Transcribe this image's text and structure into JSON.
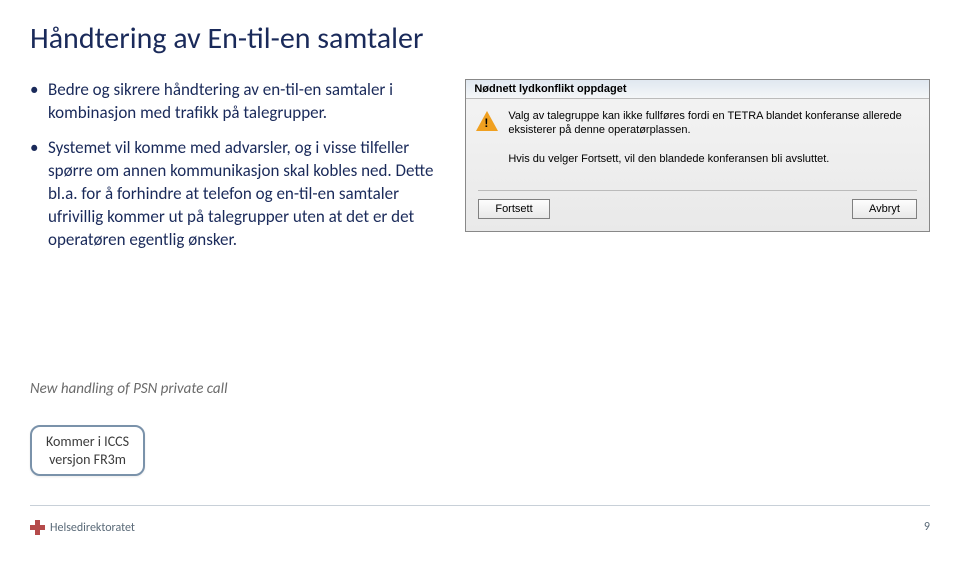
{
  "title": "Håndtering av En-til-en samtaler",
  "bullets": [
    "Bedre og sikrere håndtering av en-til-en samtaler i kombinasjon med trafikk på talegrupper.",
    "Systemet vil komme med advarsler, og i visse tilfeller spørre om annen kommunikasjon skal kobles ned. Dette bl.a. for å forhindre at telefon og en-til-en samtaler ufrivillig kommer ut på talegrupper uten at det er det operatøren egentlig ønsker."
  ],
  "dialog": {
    "title": "Nødnett lydkonflikt oppdaget",
    "line1": "Valg av talegruppe kan ikke fullføres fordi en TETRA blandet konferanse allerede eksisterer på denne operatørplassen.",
    "line2": "Hvis du velger Fortsett, vil den blandede konferansen bli avsluttet.",
    "btn_ok": "Fortsett",
    "btn_cancel": "Avbryt"
  },
  "note": "New handling of PSN private call",
  "tag_line1": "Kommer i ICCS",
  "tag_line2": "versjon FR3m",
  "logo_text": "Helsedirektoratet",
  "page_number": "9"
}
